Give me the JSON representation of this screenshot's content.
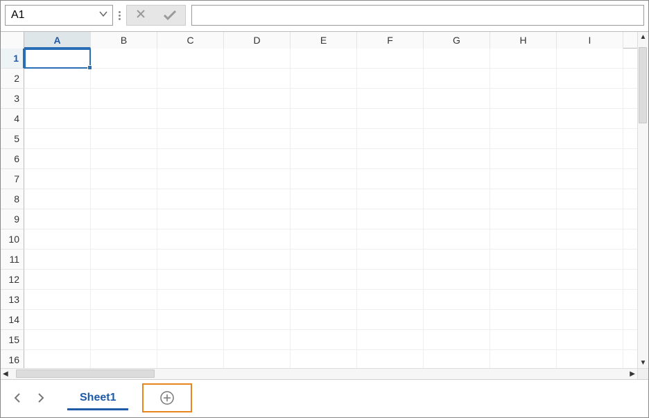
{
  "name_box": {
    "value": "A1"
  },
  "formula_bar": {
    "value": ""
  },
  "columns": [
    "A",
    "B",
    "C",
    "D",
    "E",
    "F",
    "G",
    "H",
    "I"
  ],
  "selected_column_index": 0,
  "rows": [
    1,
    2,
    3,
    4,
    5,
    6,
    7,
    8,
    9,
    10,
    11,
    12,
    13,
    14,
    15,
    16
  ],
  "selected_row_index": 0,
  "sheet_tabs": {
    "active": "Sheet1"
  },
  "scroll": {
    "v_thumb_pct": 22,
    "h_thumb_pct": 24
  }
}
